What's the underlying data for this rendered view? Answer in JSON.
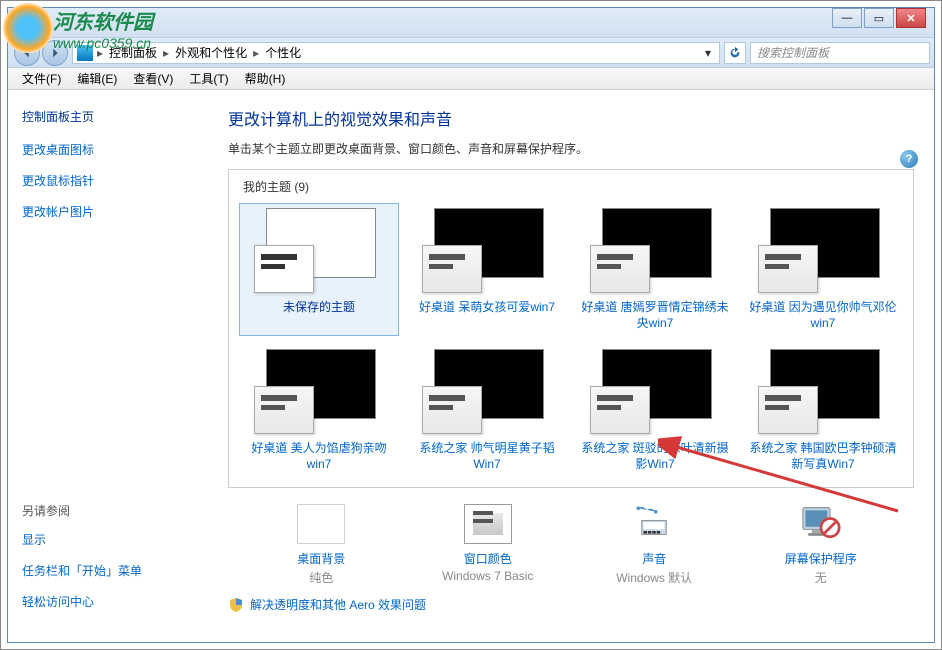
{
  "watermark": {
    "chinese": "河东软件园",
    "url": "www.pc0359.cn"
  },
  "breadcrumb": {
    "items": [
      "控制面板",
      "外观和个性化",
      "个性化"
    ]
  },
  "search": {
    "placeholder": "搜索控制面板"
  },
  "menu": {
    "file": "文件(F)",
    "edit": "编辑(E)",
    "view": "查看(V)",
    "tools": "工具(T)",
    "help": "帮助(H)"
  },
  "sidebar": {
    "title": "控制面板主页",
    "links": [
      "更改桌面图标",
      "更改鼠标指针",
      "更改帐户图片"
    ],
    "footer_title": "另请参阅",
    "footer_links": [
      "显示",
      "任务栏和「开始」菜单",
      "轻松访问中心"
    ]
  },
  "main": {
    "heading": "更改计算机上的视觉效果和声音",
    "subtext": "单击某个主题立即更改桌面背景、窗口颜色、声音和屏幕保护程序。",
    "themes_header": "我的主题 (9)",
    "themes": [
      {
        "label": "未保存的主题",
        "selected": true
      },
      {
        "label": "好桌道 呆萌女孩可爱win7",
        "selected": false
      },
      {
        "label": "好桌道 唐嫣罗晋情定锦绣未央win7",
        "selected": false
      },
      {
        "label": "好桌道 因为遇见你帅气邓伦win7",
        "selected": false
      },
      {
        "label": "好桌道 美人为馅虐狗亲吻win7",
        "selected": false
      },
      {
        "label": "系统之家 帅气明星黄子韬Win7",
        "selected": false
      },
      {
        "label": "系统之家 斑驳的绿叶清新摄影Win7",
        "selected": false
      },
      {
        "label": "系统之家 韩国欧巴李钟硕清新写真Win7",
        "selected": false
      }
    ],
    "options": {
      "background": {
        "title": "桌面背景",
        "sub": "纯色"
      },
      "color": {
        "title": "窗口颜色",
        "sub": "Windows 7 Basic"
      },
      "sound": {
        "title": "声音",
        "sub": "Windows 默认"
      },
      "saver": {
        "title": "屏幕保护程序",
        "sub": "无"
      }
    },
    "footer_link": "解决透明度和其他 Aero 效果问题"
  }
}
